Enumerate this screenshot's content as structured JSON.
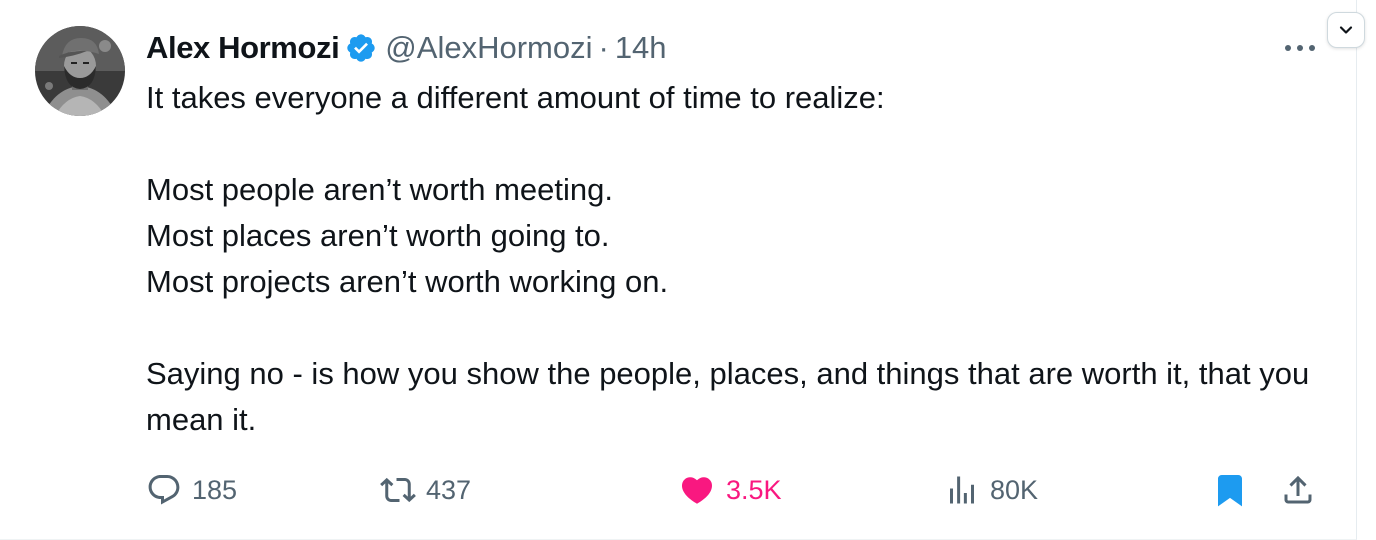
{
  "tweet": {
    "author": {
      "name": "Alex Hormozi",
      "handle": "@AlexHormozi",
      "verified": true,
      "avatar": "avatar-photo"
    },
    "separator": "·",
    "time": "14h",
    "lines": [
      "It takes everyone a different amount of time to realize:",
      "",
      "Most people aren’t worth meeting.",
      "Most places aren’t worth going to.",
      "Most projects aren’t worth working on.",
      "",
      "Saying no - is how you show the people, places, and things that are worth it, that you mean it."
    ],
    "stats": {
      "replies": "185",
      "retweets": "437",
      "likes": "3.5K",
      "views": "80K"
    },
    "state": {
      "liked": true,
      "bookmarked": true
    }
  },
  "icons": {
    "more": "more-horizontal-icon",
    "menu": "chevron-down-icon",
    "reply": "reply-icon",
    "retweet": "retweet-icon",
    "like": "heart-icon",
    "views": "views-chart-icon",
    "bookmark": "bookmark-icon",
    "share": "share-icon",
    "verified": "verified-badge-icon"
  },
  "colors": {
    "text": "#0f1419",
    "secondary": "#536471",
    "verified": "#1d9bf0",
    "like": "#f91880",
    "bookmark": "#1d9bf0"
  }
}
